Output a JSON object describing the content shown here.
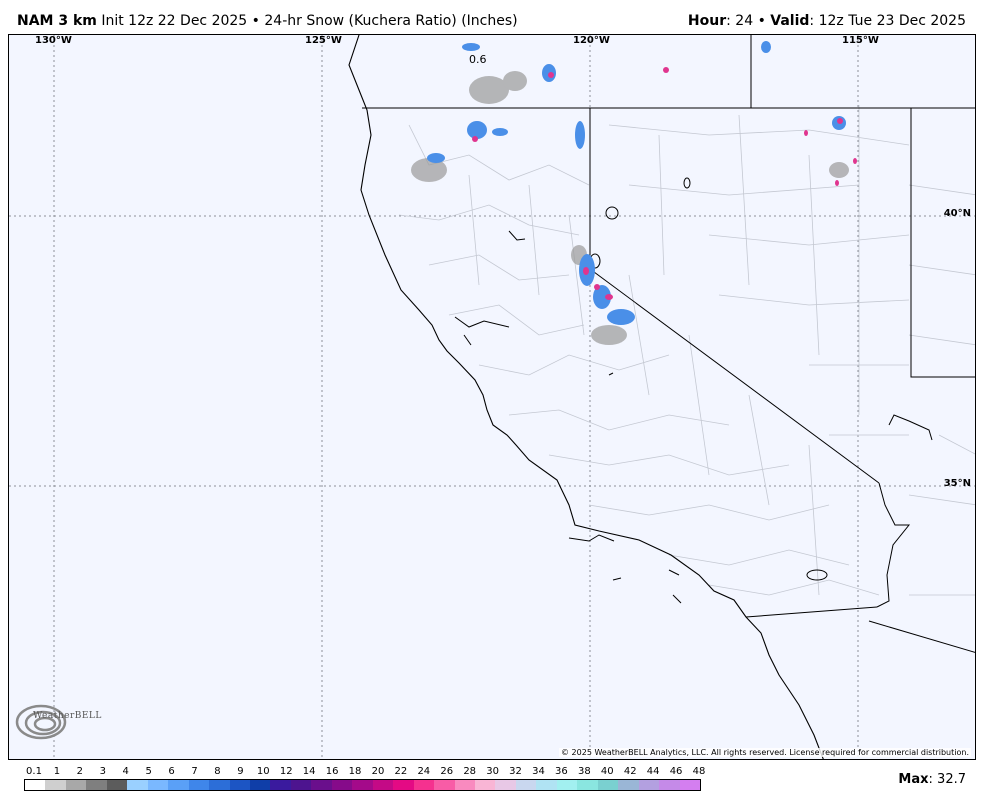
{
  "header": {
    "model": "NAM 3 km",
    "init": "Init 12z 22 Dec 2025",
    "separator": "•",
    "product": "24-hr Snow (Kuchera Ratio) (Inches)",
    "hour_label": "Hour",
    "hour_value": ": 24",
    "valid_label": "Valid",
    "valid_value": ": 12z Tue 23 Dec 2025"
  },
  "map": {
    "longitudes": [
      "130°W",
      "125°W",
      "120°W",
      "115°W"
    ],
    "latitudes": [
      "40°N",
      "35°N"
    ],
    "contour_label": "0.6",
    "copyright": "© 2025 WeatherBELL Analytics, LLC. All rights reserved. License required for commercial distribution.",
    "logo_text": "WeatherBELL",
    "logo_icon": "swirl-logo-icon"
  },
  "legend": {
    "ticks": [
      "0.1",
      "1",
      "2",
      "3",
      "4",
      "5",
      "6",
      "7",
      "8",
      "9",
      "10",
      "12",
      "14",
      "16",
      "18",
      "20",
      "22",
      "24",
      "26",
      "28",
      "30",
      "32",
      "34",
      "36",
      "38",
      "40",
      "42",
      "44",
      "46",
      "48"
    ],
    "colors": [
      "#ffffff",
      "#cfcfcf",
      "#a8a8a8",
      "#7f7f7f",
      "#5c5c5c",
      "#9ad0ff",
      "#7ab8ff",
      "#5aa0f7",
      "#3f86ea",
      "#2c6ed8",
      "#1c55c4",
      "#0f3ea8",
      "#3a1a9e",
      "#4d148f",
      "#6a0f8c",
      "#860b8a",
      "#a40a8a",
      "#c40a86",
      "#e40a84",
      "#f5318f",
      "#f85ca6",
      "#f98abf",
      "#f9b5d5",
      "#e8c8e6",
      "#c9d7ef",
      "#b0e3f3",
      "#a2f0f0",
      "#8ae6e0",
      "#7ad0d0",
      "#9ab6d6",
      "#b3a0e0",
      "#c58ae8",
      "#d47ef0"
    ],
    "max_label": "Max",
    "max_value": ": 32.7"
  }
}
